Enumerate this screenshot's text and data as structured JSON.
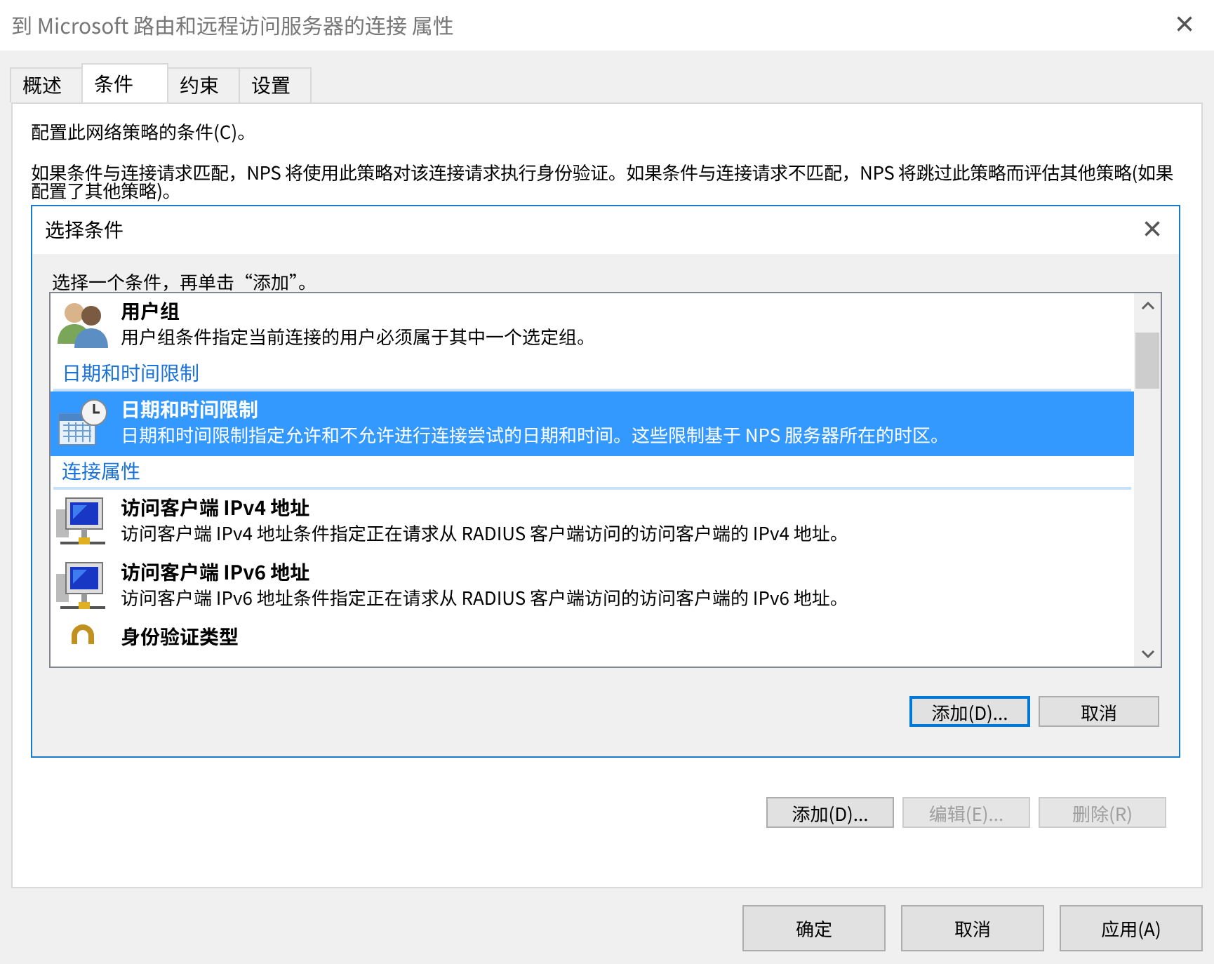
{
  "window": {
    "title": "到 Microsoft 路由和远程访问服务器的连接 属性",
    "close": "×"
  },
  "tabs": [
    {
      "label": "概述",
      "selected": false
    },
    {
      "label": "条件",
      "selected": true
    },
    {
      "label": "约束",
      "selected": false
    },
    {
      "label": "设置",
      "selected": false
    }
  ],
  "panel": {
    "heading": "配置此网络策略的条件(C)。",
    "description": "如果条件与连接请求匹配，NPS 将使用此策略对该连接请求执行身份验证。如果条件与连接请求不匹配，NPS 将跳过此策略而评估其他策略(如果配置了其他策略)。"
  },
  "dialog": {
    "title": "选择条件",
    "close": "×",
    "prompt": "选择一个条件，再单击“添加”。",
    "items": [
      {
        "kind": "users",
        "title": "用户组",
        "description": "用户组条件指定当前连接的用户必须属于其中一个选定组。",
        "selected": false
      },
      {
        "kind": "header",
        "title": "日期和时间限制"
      },
      {
        "kind": "calendar",
        "title": "日期和时间限制",
        "description": "日期和时间限制指定允许和不允许进行连接尝试的日期和时间。这些限制基于 NPS 服务器所在的时区。",
        "selected": true
      },
      {
        "kind": "header",
        "title": "连接属性"
      },
      {
        "kind": "computer",
        "title": "访问客户端 IPv4 地址",
        "description": "访问客户端 IPv4 地址条件指定正在请求从 RADIUS 客户端访问的访问客户端的 IPv4 地址。",
        "selected": false
      },
      {
        "kind": "computer",
        "title": "访问客户端 IPv6 地址",
        "description": "访问客户端 IPv6 地址条件指定正在请求从 RADIUS 客户端访问的访问客户端的 IPv6 地址。",
        "selected": false
      },
      {
        "kind": "lock",
        "title": "身份验证类型",
        "selected": false
      }
    ],
    "buttons": [
      {
        "label": "添加(D)...",
        "disabled": false,
        "focused": true
      },
      {
        "label": "取消",
        "disabled": false,
        "focused": false
      }
    ]
  },
  "panel_buttons": [
    {
      "label": "添加(D)...",
      "disabled": false
    },
    {
      "label": "编辑(E)...",
      "disabled": true
    },
    {
      "label": "删除(R)",
      "disabled": true
    }
  ],
  "footer_buttons": [
    {
      "label": "确定"
    },
    {
      "label": "取消"
    },
    {
      "label": "应用(A)"
    }
  ]
}
